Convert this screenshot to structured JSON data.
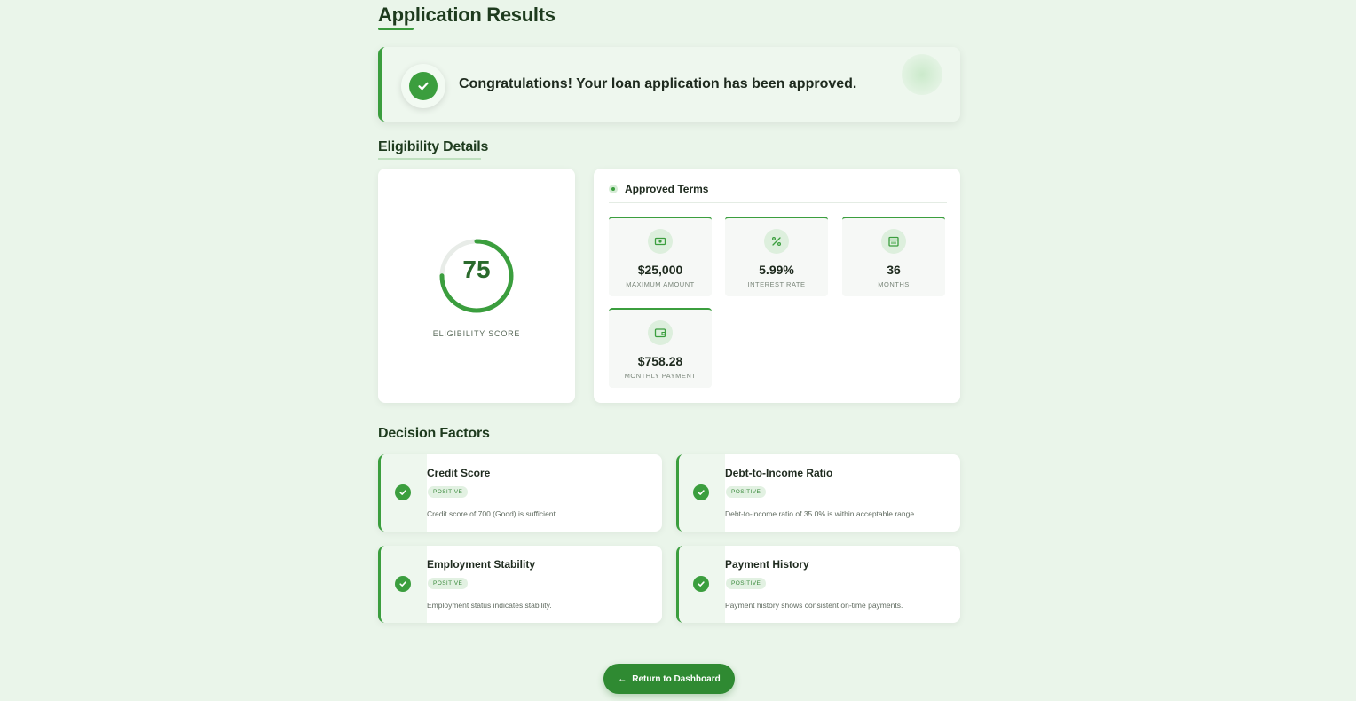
{
  "page": {
    "title": "Application Results"
  },
  "alert": {
    "icon": "check-circle-icon",
    "message": "Congratulations! Your loan application has been approved."
  },
  "eligibility": {
    "section_title": "Eligibility Details",
    "score": "75",
    "score_fraction": 0.75,
    "score_label": "ELIGIBILITY SCORE"
  },
  "terms": {
    "title": "Approved Terms",
    "items": [
      {
        "icon": "cash-icon",
        "value": "$25,000",
        "label": "MAXIMUM AMOUNT"
      },
      {
        "icon": "percent-icon",
        "value": "5.99%",
        "label": "INTEREST RATE"
      },
      {
        "icon": "calendar-icon",
        "value": "36",
        "label": "MONTHS"
      },
      {
        "icon": "wallet-icon",
        "value": "$758.28",
        "label": "MONTHLY PAYMENT"
      }
    ]
  },
  "factors": {
    "section_title": "Decision Factors",
    "items": [
      {
        "title": "Credit Score",
        "badge": "POSITIVE",
        "description": "Credit score of 700 (Good) is sufficient."
      },
      {
        "title": "Debt-to-Income Ratio",
        "badge": "POSITIVE",
        "description": "Debt-to-income ratio of 35.0% is within acceptable range."
      },
      {
        "title": "Employment Stability",
        "badge": "POSITIVE",
        "description": "Employment status indicates stability."
      },
      {
        "title": "Payment History",
        "badge": "POSITIVE",
        "description": "Payment history shows consistent on-time payments."
      }
    ]
  },
  "actions": {
    "return_label": "Return to Dashboard",
    "return_icon": "arrow-left-icon"
  },
  "colors": {
    "accent": "#3b9e3e",
    "background": "#eaf5ea"
  }
}
